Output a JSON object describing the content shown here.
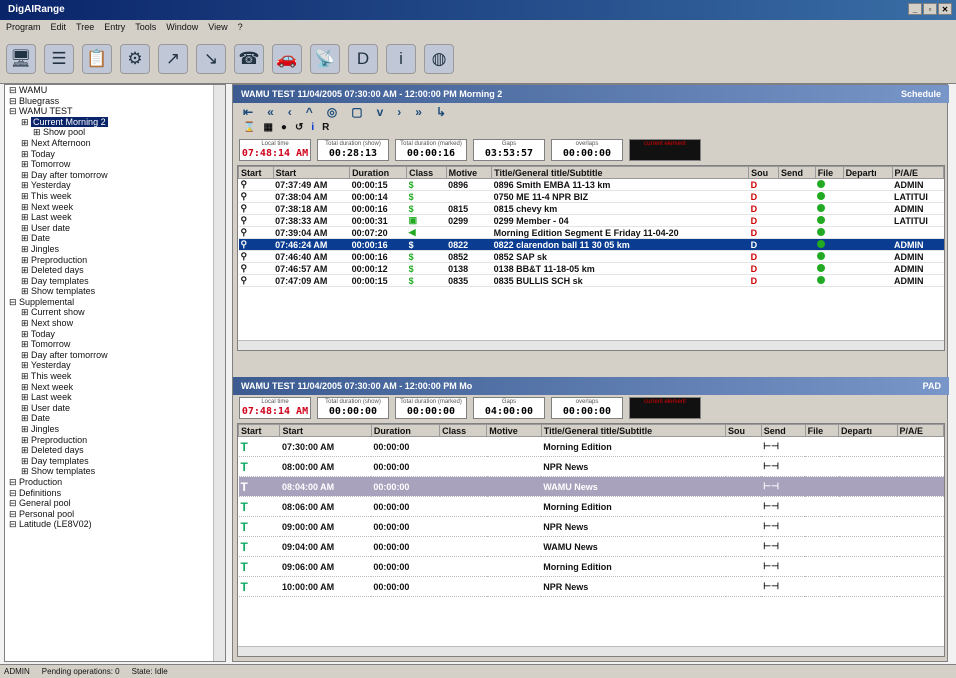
{
  "app": {
    "title": "DigAIRange"
  },
  "menu": [
    "Program",
    "Edit",
    "Tree",
    "Entry",
    "Tools",
    "Window",
    "View",
    "?"
  ],
  "toolbar_icons": [
    "monitor-icon",
    "stack-icon",
    "clipboard-icon",
    "tools-icon",
    "chart-icon",
    "chart-gray-icon",
    "handset-icon",
    "car-icon",
    "satellite-icon",
    "d-logo-icon",
    "info-icon",
    "globe-icon"
  ],
  "tree": [
    {
      "label": "WAMU",
      "level": 0
    },
    {
      "label": "Bluegrass",
      "level": 0
    },
    {
      "label": "WAMU TEST",
      "level": 0
    },
    {
      "label": "Current Morning 2",
      "level": 1,
      "selected": true
    },
    {
      "label": "Show pool",
      "level": 2
    },
    {
      "label": "Next Afternoon",
      "level": 1
    },
    {
      "label": "Today",
      "level": 1
    },
    {
      "label": "Tomorrow",
      "level": 1
    },
    {
      "label": "Day after tomorrow",
      "level": 1
    },
    {
      "label": "Yesterday",
      "level": 1
    },
    {
      "label": "This week",
      "level": 1
    },
    {
      "label": "Next week",
      "level": 1
    },
    {
      "label": "Last week",
      "level": 1
    },
    {
      "label": "User date",
      "level": 1
    },
    {
      "label": "Date",
      "level": 1
    },
    {
      "label": "Jingles",
      "level": 1
    },
    {
      "label": "Preproduction",
      "level": 1
    },
    {
      "label": "Deleted days",
      "level": 1
    },
    {
      "label": "Day templates",
      "level": 1
    },
    {
      "label": "Show templates",
      "level": 1
    },
    {
      "label": "Supplemental",
      "level": 0
    },
    {
      "label": "Current show",
      "level": 1
    },
    {
      "label": "Next show",
      "level": 1
    },
    {
      "label": "Today",
      "level": 1
    },
    {
      "label": "Tomorrow",
      "level": 1
    },
    {
      "label": "Day after tomorrow",
      "level": 1
    },
    {
      "label": "Yesterday",
      "level": 1
    },
    {
      "label": "This week",
      "level": 1
    },
    {
      "label": "Next week",
      "level": 1
    },
    {
      "label": "Last week",
      "level": 1
    },
    {
      "label": "User date",
      "level": 1
    },
    {
      "label": "Date",
      "level": 1
    },
    {
      "label": "Jingles",
      "level": 1
    },
    {
      "label": "Preproduction",
      "level": 1
    },
    {
      "label": "Deleted days",
      "level": 1
    },
    {
      "label": "Day templates",
      "level": 1
    },
    {
      "label": "Show templates",
      "level": 1
    },
    {
      "label": "Production",
      "level": 0
    },
    {
      "label": "Definitions",
      "level": 0
    },
    {
      "label": "General pool",
      "level": 0
    },
    {
      "label": "Personal pool",
      "level": 0
    },
    {
      "label": "Latitude (LE8V02)",
      "level": 0
    }
  ],
  "top": {
    "header": "WAMU TEST 11/04/2005 07:30:00 AM - 12:00:00 PM Morning 2",
    "mode": "Schedule",
    "nav": [
      "⇤",
      "«",
      "‹",
      "^",
      "◎",
      "▢",
      "v",
      "›",
      "»",
      "↳"
    ],
    "info": [
      {
        "label": "Local time",
        "value": "07:48:14 AM",
        "style": "red"
      },
      {
        "label": "Total duration (show)",
        "value": "00:28:13"
      },
      {
        "label": "Total duration (marked)",
        "value": "00:00:16"
      },
      {
        "label": "Gaps",
        "value": "03:53:57"
      },
      {
        "label": "overlaps",
        "value": "00:00:00"
      },
      {
        "label": "current element",
        "value": "",
        "style": "dark"
      }
    ],
    "columns": [
      "Start",
      "Start",
      "Duration",
      "Class",
      "Motive",
      "Title/General title/Subtitle",
      "Sou",
      "Send",
      "File",
      "Departı",
      "P/A/E"
    ],
    "rows": [
      {
        "start": "07:37:49 AM",
        "dur": "00:00:15",
        "cls": "$",
        "motive": "0896",
        "title": "0896 Smith EMBA 11-13 km",
        "pae": "ADMIN"
      },
      {
        "start": "07:38:04 AM",
        "dur": "00:00:14",
        "cls": "$",
        "motive": "",
        "title": "0750 ME 11-4 NPR BIZ",
        "pae": "LATITUI"
      },
      {
        "start": "07:38:18 AM",
        "dur": "00:00:16",
        "cls": "$",
        "motive": "0815",
        "title": "0815 chevy km",
        "pae": "ADMIN"
      },
      {
        "start": "07:38:33 AM",
        "dur": "00:00:31",
        "cls": "▣",
        "motive": "0299",
        "title": "0299 Member - 04",
        "pae": "LATITUI"
      },
      {
        "start": "07:39:04 AM",
        "dur": "00:07:20",
        "cls": "◀",
        "motive": "",
        "title": "Morning Edition Segment E Friday 11-04-20",
        "pae": ""
      },
      {
        "start": "07:46:24 AM",
        "dur": "00:00:16",
        "cls": "$",
        "motive": "0822",
        "title": "0822 clarendon ball 11 30 05 km",
        "pae": "ADMIN",
        "highlight": true
      },
      {
        "start": "07:46:40 AM",
        "dur": "00:00:16",
        "cls": "$",
        "motive": "0852",
        "title": "0852 SAP sk",
        "pae": "ADMIN"
      },
      {
        "start": "07:46:57 AM",
        "dur": "00:00:12",
        "cls": "$",
        "motive": "0138",
        "title": "0138 BB&T 11-18-05 km",
        "pae": "ADMIN"
      },
      {
        "start": "07:47:09 AM",
        "dur": "00:00:15",
        "cls": "$",
        "motive": "0835",
        "title": "0835 BULLIS SCH sk",
        "pae": "ADMIN"
      }
    ]
  },
  "bottom": {
    "header": "WAMU TEST 11/04/2005 07:30:00 AM - 12:00:00 PM Mo",
    "mode": "PAD",
    "info": [
      {
        "label": "Local time",
        "value": "07:48:14 AM",
        "style": "red"
      },
      {
        "label": "Total duration (show)",
        "value": "00:00:00"
      },
      {
        "label": "Total duration (marked)",
        "value": "00:00:00"
      },
      {
        "label": "Gaps",
        "value": "04:00:00"
      },
      {
        "label": "overlaps",
        "value": "00:00:00"
      },
      {
        "label": "current element",
        "value": "",
        "style": "dark"
      }
    ],
    "columns": [
      "Start",
      "Start",
      "Duration",
      "Class",
      "Motive",
      "Title/General title/Subtitle",
      "Sou",
      "Send",
      "File",
      "Departı",
      "P/A/E"
    ],
    "rows": [
      {
        "start": "07:30:00 AM",
        "dur": "00:00:00",
        "title": "Morning Edition"
      },
      {
        "start": "08:00:00 AM",
        "dur": "00:00:00",
        "title": "NPR News"
      },
      {
        "start": "08:04:00 AM",
        "dur": "00:00:00",
        "title": "WAMU News",
        "highlight": true
      },
      {
        "start": "08:06:00 AM",
        "dur": "00:00:00",
        "title": "Morning Edition"
      },
      {
        "start": "09:00:00 AM",
        "dur": "00:00:00",
        "title": "NPR News"
      },
      {
        "start": "09:04:00 AM",
        "dur": "00:00:00",
        "title": "WAMU News"
      },
      {
        "start": "09:06:00 AM",
        "dur": "00:00:00",
        "title": "Morning Edition"
      },
      {
        "start": "10:00:00 AM",
        "dur": "00:00:00",
        "title": "NPR News"
      }
    ]
  },
  "status": {
    "user": "ADMIN",
    "pending": "Pending operations: 0",
    "state": "State: Idle"
  }
}
